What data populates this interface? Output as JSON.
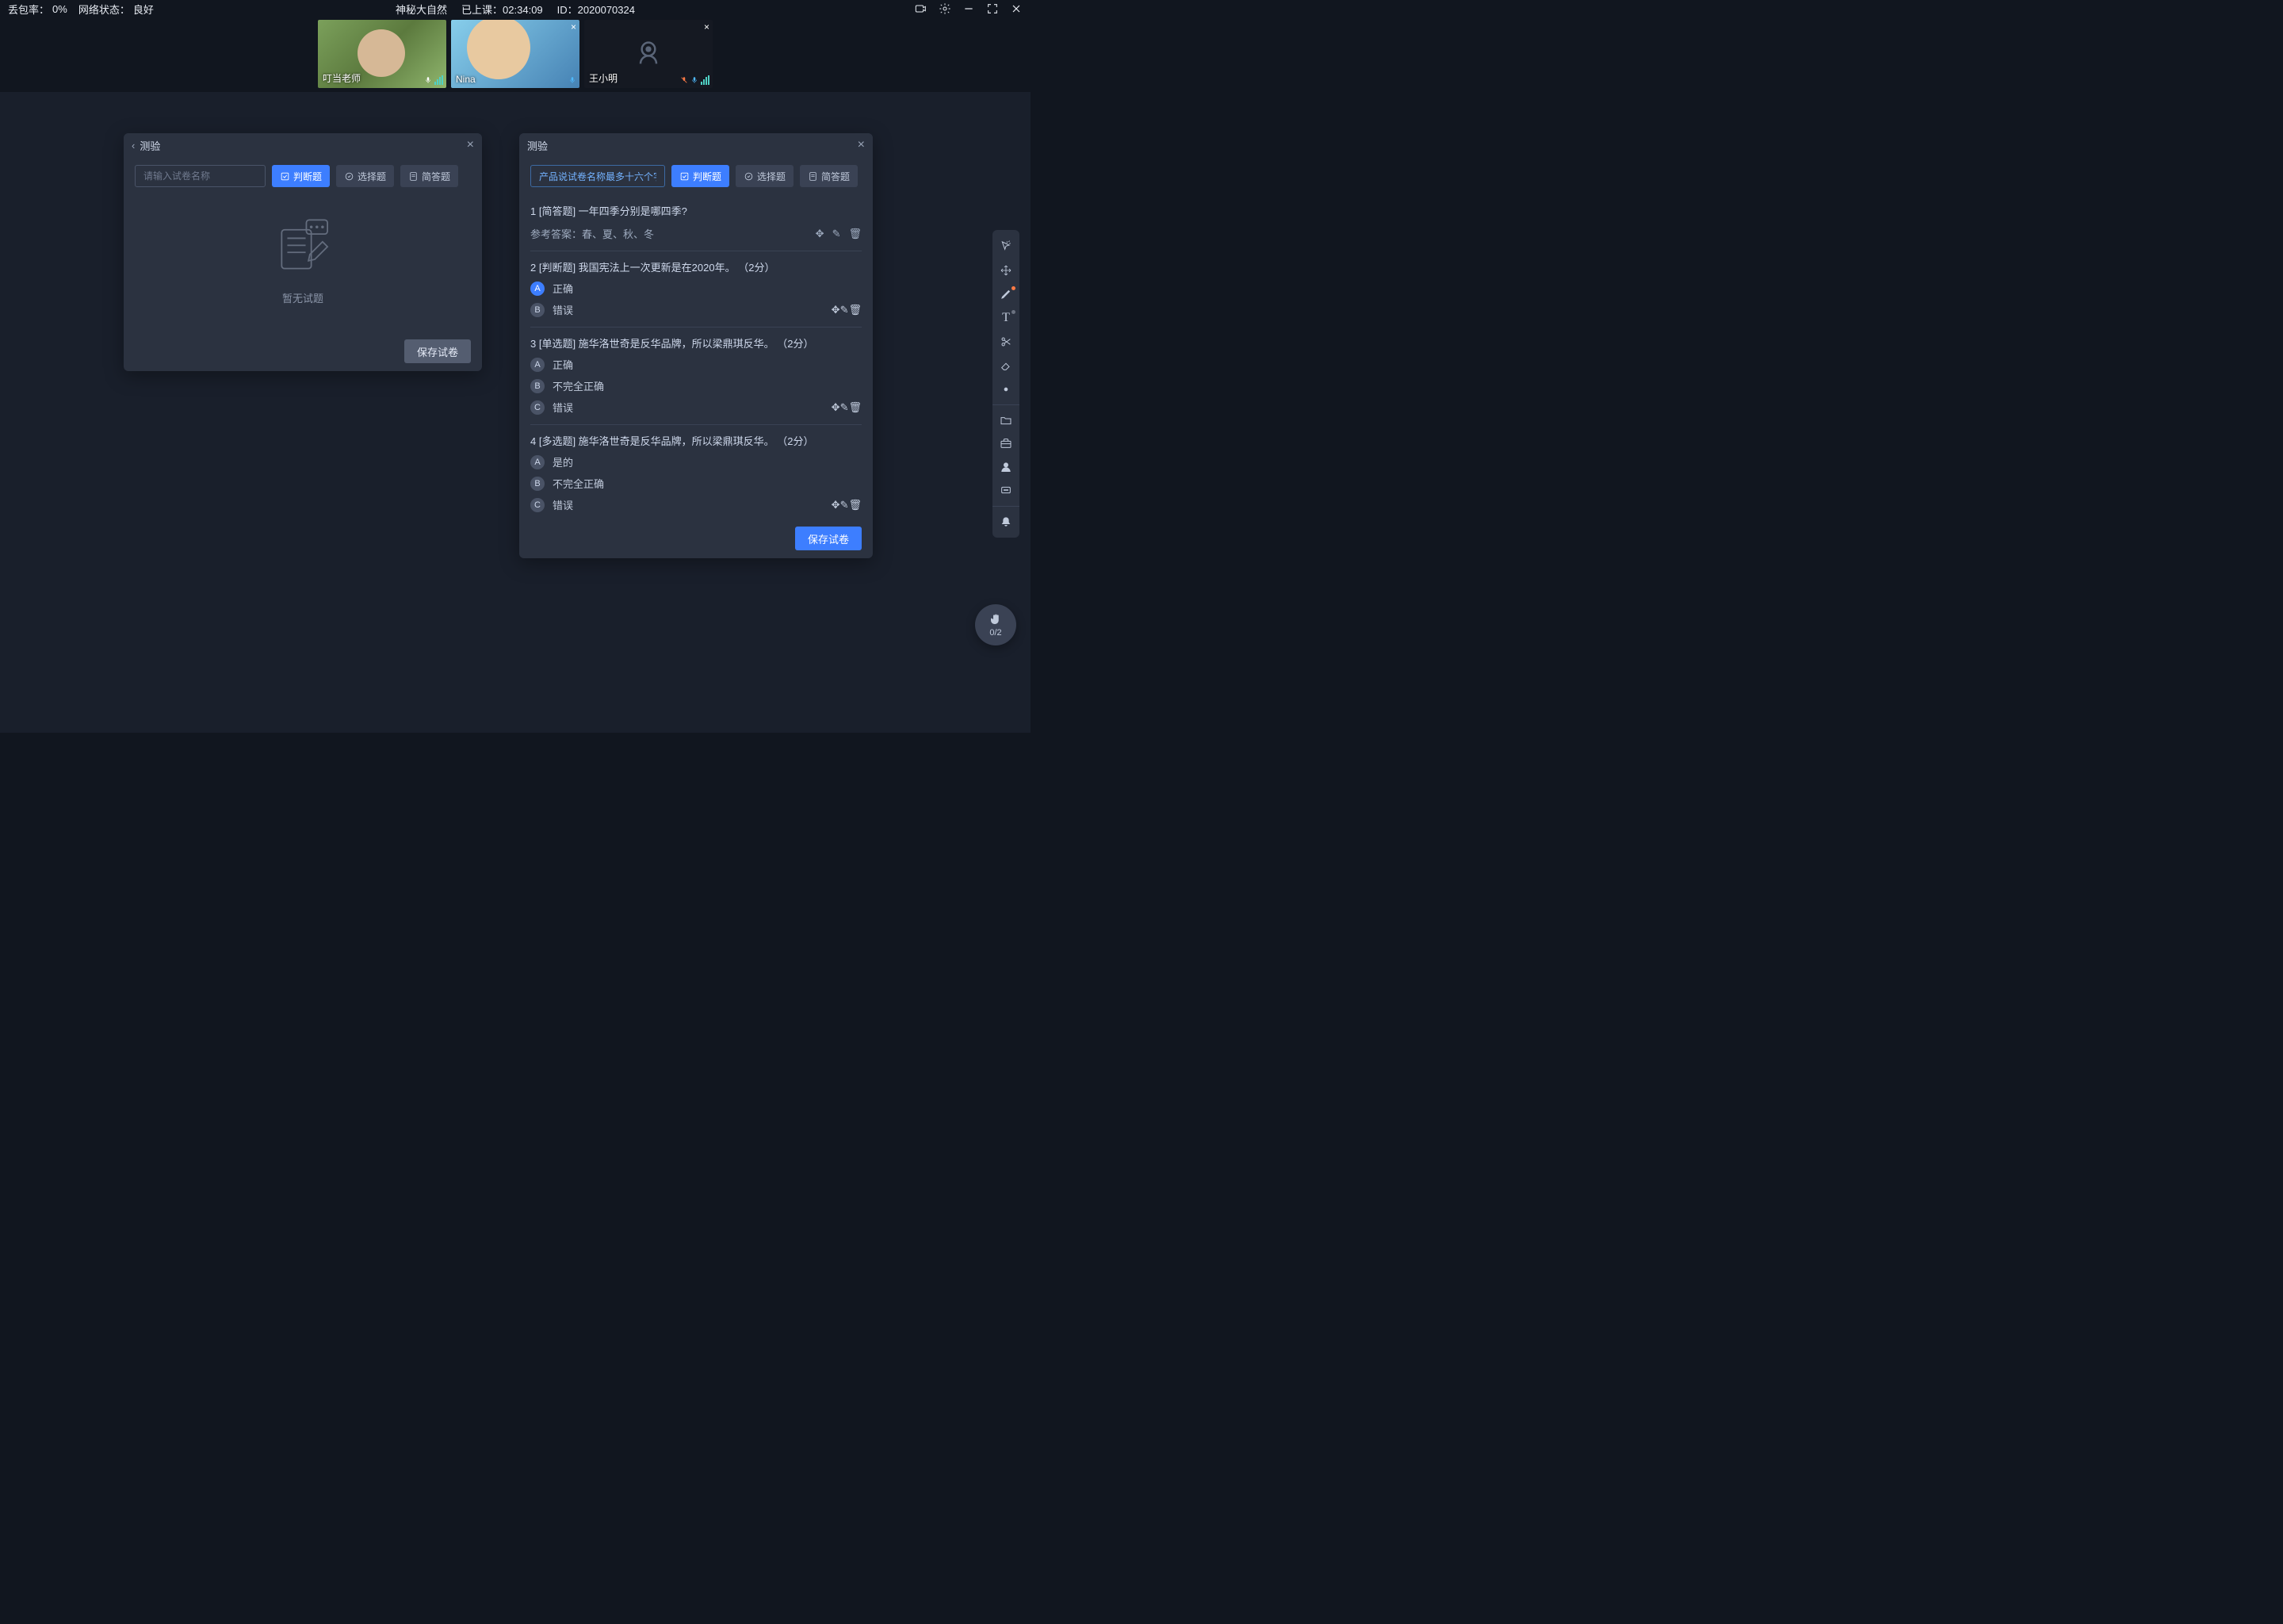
{
  "topbar": {
    "packet_loss_label": "丢包率：",
    "packet_loss_value": "0%",
    "net_status_label": "网络状态：",
    "net_status_value": "良好",
    "course_title": "神秘大自然",
    "elapsed_label": "已上课：",
    "elapsed_value": "02:34:09",
    "id_label": "ID：",
    "id_value": "2020070324"
  },
  "videos": [
    {
      "name": "叮当老师",
      "camera_on": true,
      "closeable": false,
      "mic_color": "#ffffff"
    },
    {
      "name": "Nina",
      "camera_on": true,
      "closeable": true,
      "mic_color": "#4fbaff"
    },
    {
      "name": "王小明",
      "camera_on": false,
      "closeable": true,
      "mic_color": "#4fbaff",
      "mic_muted_color": "#ff7a45"
    }
  ],
  "panel_left": {
    "title": "测验",
    "input_placeholder": "请输入试卷名称",
    "chip_judge": "判断题",
    "chip_choice": "选择题",
    "chip_short": "简答题",
    "empty_text": "暂无试题",
    "save": "保存试卷"
  },
  "panel_right": {
    "title": "测验",
    "name_value": "产品说试卷名称最多十六个字",
    "chip_judge": "判断题",
    "chip_choice": "选择题",
    "chip_short": "简答题",
    "save": "保存试卷",
    "answer_prefix": "参考答案：",
    "questions": [
      {
        "n": "1",
        "tag": "[简答题]",
        "text": "一年四季分别是哪四季?",
        "answer": "春、夏、秋、冬"
      },
      {
        "n": "2",
        "tag": "[判断题]",
        "text": "我国宪法上一次更新是在2020年。 （2分）",
        "options": [
          {
            "key": "A",
            "label": "正确",
            "selected": true
          },
          {
            "key": "B",
            "label": "错误",
            "selected": false
          }
        ]
      },
      {
        "n": "3",
        "tag": "[单选题]",
        "text": "施华洛世奇是反华品牌，所以梁鼎琪反华。 （2分）",
        "options": [
          {
            "key": "A",
            "label": "正确",
            "selected": false
          },
          {
            "key": "B",
            "label": "不完全正确",
            "selected": false
          },
          {
            "key": "C",
            "label": "错误",
            "selected": false
          }
        ]
      },
      {
        "n": "4",
        "tag": "[多选题]",
        "text": "施华洛世奇是反华品牌，所以梁鼎琪反华。 （2分）",
        "options": [
          {
            "key": "A",
            "label": "是的",
            "selected": false
          },
          {
            "key": "B",
            "label": "不完全正确",
            "selected": false
          },
          {
            "key": "C",
            "label": "错误",
            "selected": false
          }
        ]
      }
    ]
  },
  "hand_fab": "0/2"
}
